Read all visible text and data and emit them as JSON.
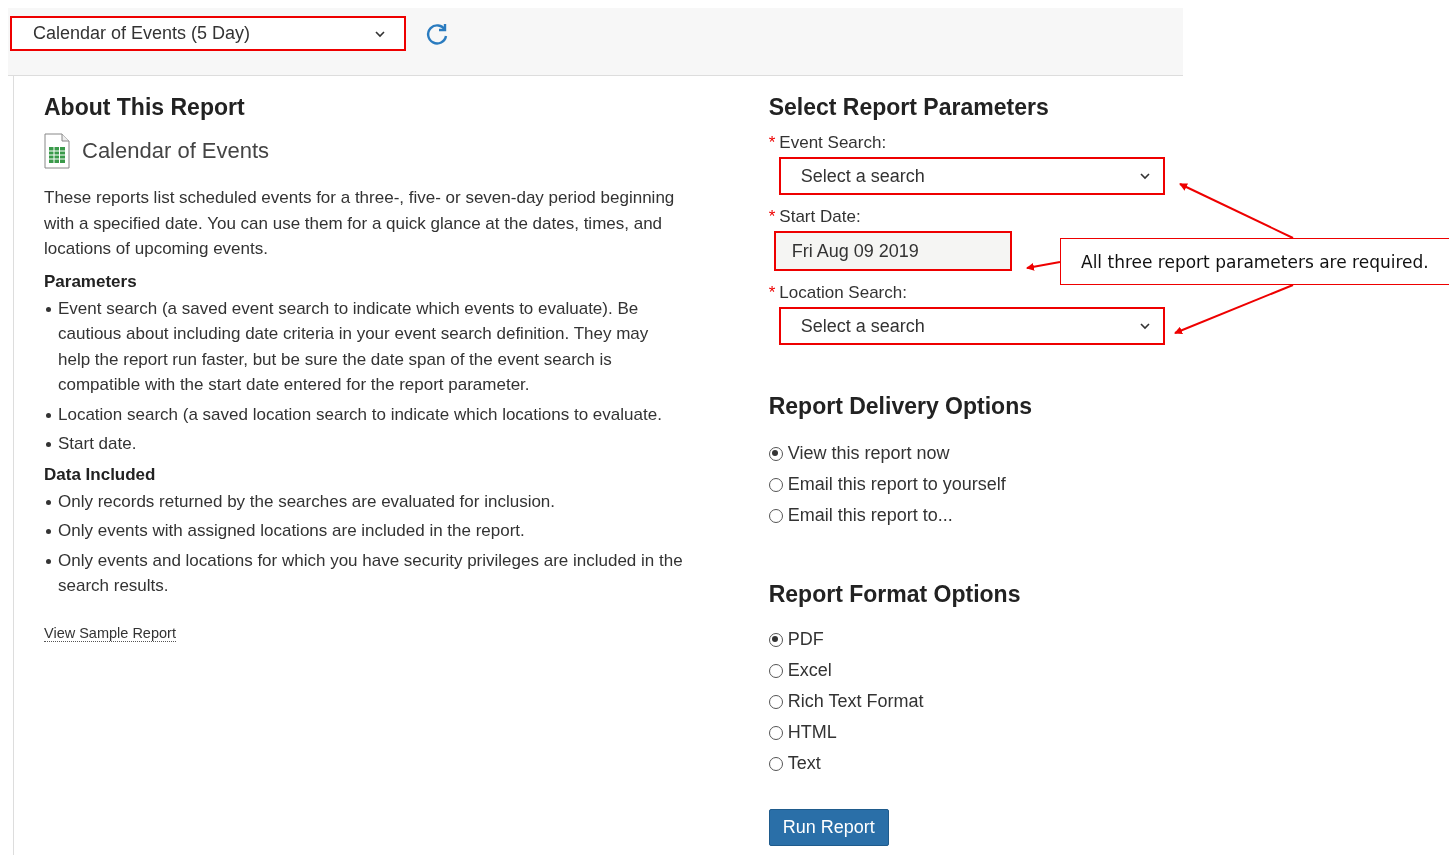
{
  "report_picker": {
    "value": "Calendar of Events (5 Day)",
    "highlighted": true
  },
  "about": {
    "heading": "About This Report",
    "report_name": "Calendar of Events",
    "description": "These reports list scheduled events for a three-, five- or seven-day period beginning with a specified date. You can use them for a quick glance at the dates, times, and locations of upcoming events.",
    "sections": [
      {
        "heading": "Parameters",
        "items": [
          "Event search (a saved event search to indicate which events to evaluate). Be cautious about including date criteria in your event search definition. They may help the report run faster, but be sure the date span of the event search is compatible with the start date entered for the report parameter.",
          "Location search (a saved location search to indicate which locations to evaluate.",
          "Start date."
        ]
      },
      {
        "heading": "Data Included",
        "items": [
          "Only records returned by the searches are evaluated for inclusion.",
          "Only events with assigned locations are included in the report.",
          "Only events and locations for which you have security privileges are included in the search results."
        ]
      }
    ],
    "sample_link": "View Sample Report"
  },
  "parameters": {
    "heading": "Select Report Parameters",
    "fields": [
      {
        "kind": "select",
        "label": "Event Search:",
        "required_mark": "*",
        "value": "Select a search",
        "highlighted": true
      },
      {
        "kind": "date",
        "label": "Start Date:",
        "required_mark": "*",
        "value": "Fri Aug 09 2019",
        "highlighted": true
      },
      {
        "kind": "select",
        "label": "Location Search:",
        "required_mark": "*",
        "value": "Select a search",
        "highlighted": true
      }
    ]
  },
  "delivery": {
    "heading": "Report Delivery Options",
    "options": [
      {
        "label": "View this report now",
        "selected": true
      },
      {
        "label": "Email this report to yourself",
        "selected": false
      },
      {
        "label": "Email this report to...",
        "selected": false
      }
    ]
  },
  "format": {
    "heading": "Report Format Options",
    "options": [
      {
        "label": "PDF",
        "selected": true
      },
      {
        "label": "Excel",
        "selected": false
      },
      {
        "label": "Rich Text Format",
        "selected": false
      },
      {
        "label": "HTML",
        "selected": false
      },
      {
        "label": "Text",
        "selected": false
      }
    ]
  },
  "run_button": "Run Report",
  "callout": {
    "text": "All three report parameters are required."
  }
}
